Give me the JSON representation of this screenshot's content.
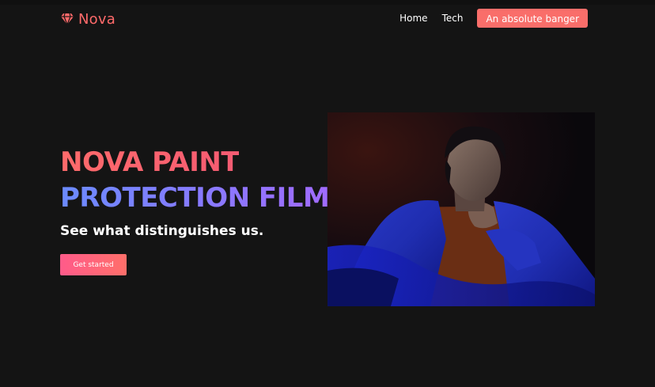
{
  "brand": {
    "name": "Nova",
    "icon": "gem-icon",
    "color": "#ff6a6a"
  },
  "nav": {
    "links": [
      "Home",
      "Tech"
    ],
    "cta_label": "An absolute banger",
    "cta_color": "#f96e6a"
  },
  "hero": {
    "title_line1": "NOVA PAINT",
    "title_line2": "PROTECTION FILM",
    "subtitle": "See what distinguishes us.",
    "button_label": "Get started",
    "title_line1_colors": [
      "#ff6b6b",
      "#f45b72"
    ],
    "title_line2_colors": [
      "#6b8bff",
      "#a16bff"
    ]
  },
  "colors": {
    "background": "#141414"
  }
}
